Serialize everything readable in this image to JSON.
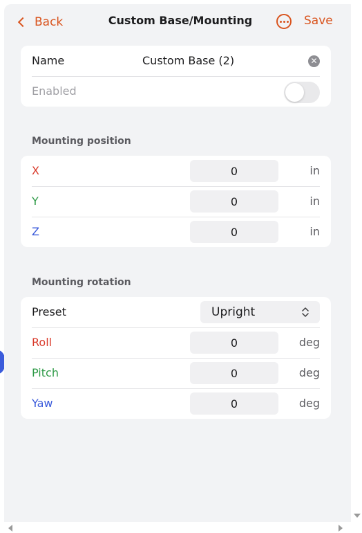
{
  "header": {
    "back_label": "Back",
    "title": "Custom Base/Mounting",
    "save_label": "Save",
    "more_icon": "more-horizontal-circle-icon"
  },
  "general": {
    "name_label": "Name",
    "name_value": "Custom Base (2)",
    "enabled_label": "Enabled",
    "enabled": false
  },
  "mounting_position": {
    "section_label": "Mounting position",
    "rows": [
      {
        "axis": "X",
        "value": "0",
        "unit": "in"
      },
      {
        "axis": "Y",
        "value": "0",
        "unit": "in"
      },
      {
        "axis": "Z",
        "value": "0",
        "unit": "in"
      }
    ]
  },
  "mounting_rotation": {
    "section_label": "Mounting rotation",
    "preset_label": "Preset",
    "preset_value": "Upright",
    "rows": [
      {
        "axis": "Roll",
        "value": "0",
        "unit": "deg"
      },
      {
        "axis": "Pitch",
        "value": "0",
        "unit": "deg"
      },
      {
        "axis": "Yaw",
        "value": "0",
        "unit": "deg"
      }
    ]
  },
  "colors": {
    "accent": "#d9541e",
    "x_axis": "#d93a2b",
    "y_axis": "#2e9a47",
    "z_axis": "#3b5bdb"
  }
}
